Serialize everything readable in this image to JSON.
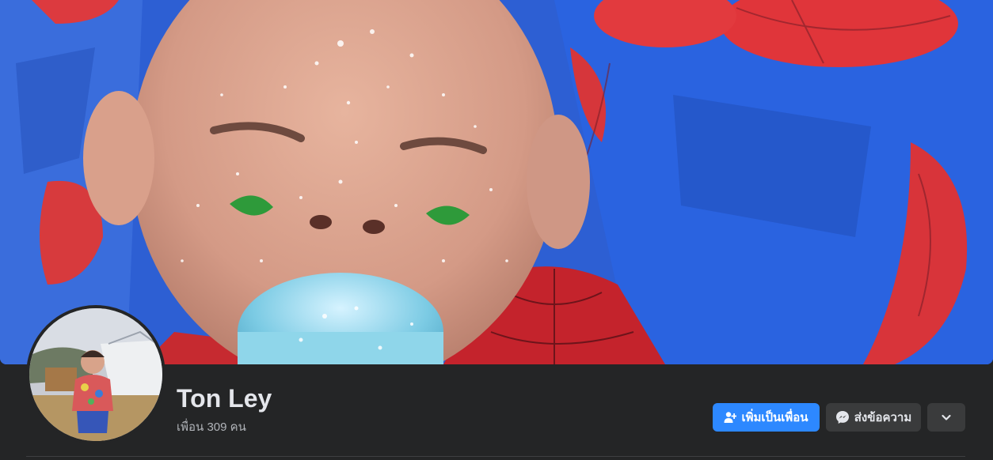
{
  "profile": {
    "name": "Ton Ley",
    "friends_text": "เพื่อน 309 คน"
  },
  "actions": {
    "add_friend_label": "เพิ่มเป็นเพื่อน",
    "message_label": "ส่งข้อความ"
  },
  "colors": {
    "header_bg": "#242526",
    "primary_button": "#2d88ff",
    "secondary_button": "#3a3b3c",
    "name_text": "#e4e6eb",
    "sub_text": "#b0b3b8"
  },
  "icons": {
    "add_friend": "person-plus-icon",
    "message": "messenger-icon",
    "more": "chevron-down-icon"
  }
}
